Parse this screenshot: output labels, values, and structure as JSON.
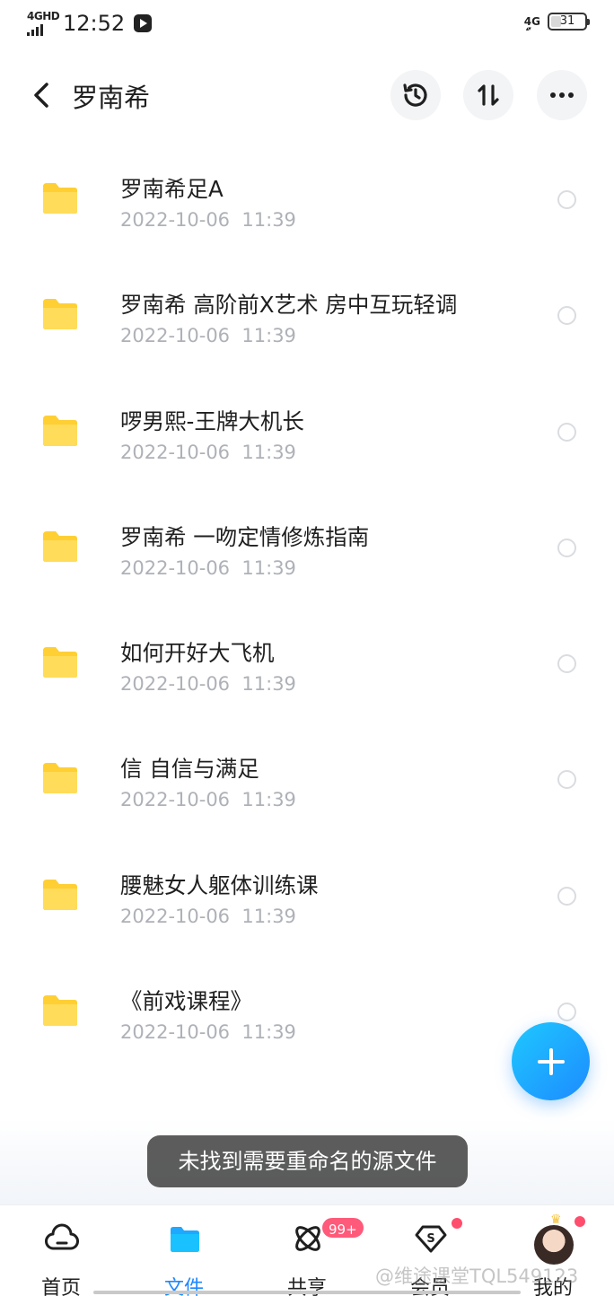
{
  "status_bar": {
    "network_left": "4GHD",
    "time": "12:52",
    "network_right": "4G",
    "battery": "31"
  },
  "header": {
    "title": "罗南希",
    "buttons": [
      "history-icon",
      "sort-icon",
      "more-icon"
    ]
  },
  "files": [
    {
      "name": "罗南希足A",
      "date": "2022-10-06  11:39"
    },
    {
      "name": "罗南希 高阶前X艺术 房中互玩轻调",
      "date": "2022-10-06  11:39"
    },
    {
      "name": "啰男熙-王牌大机长",
      "date": "2022-10-06  11:39"
    },
    {
      "name": "罗南希 一吻定情修炼指南",
      "date": "2022-10-06  11:39"
    },
    {
      "name": "如何开好大飞机",
      "date": "2022-10-06  11:39"
    },
    {
      "name": "信 自信与满足",
      "date": "2022-10-06  11:39"
    },
    {
      "name": "腰魅女人躯体训练课",
      "date": "2022-10-06  11:39"
    },
    {
      "name": "《前戏课程》",
      "date": "2022-10-06  11:39"
    }
  ],
  "toast": "未找到需要重命名的源文件",
  "nav": {
    "home": "首页",
    "files": "文件",
    "share": "共享",
    "share_badge": "99+",
    "vip": "会员",
    "me": "我的"
  },
  "watermark": "@维途课堂TQL549123",
  "colors": {
    "accent": "#1e88ff",
    "folder": "#ffd84a",
    "badge": "#ff5a79"
  }
}
